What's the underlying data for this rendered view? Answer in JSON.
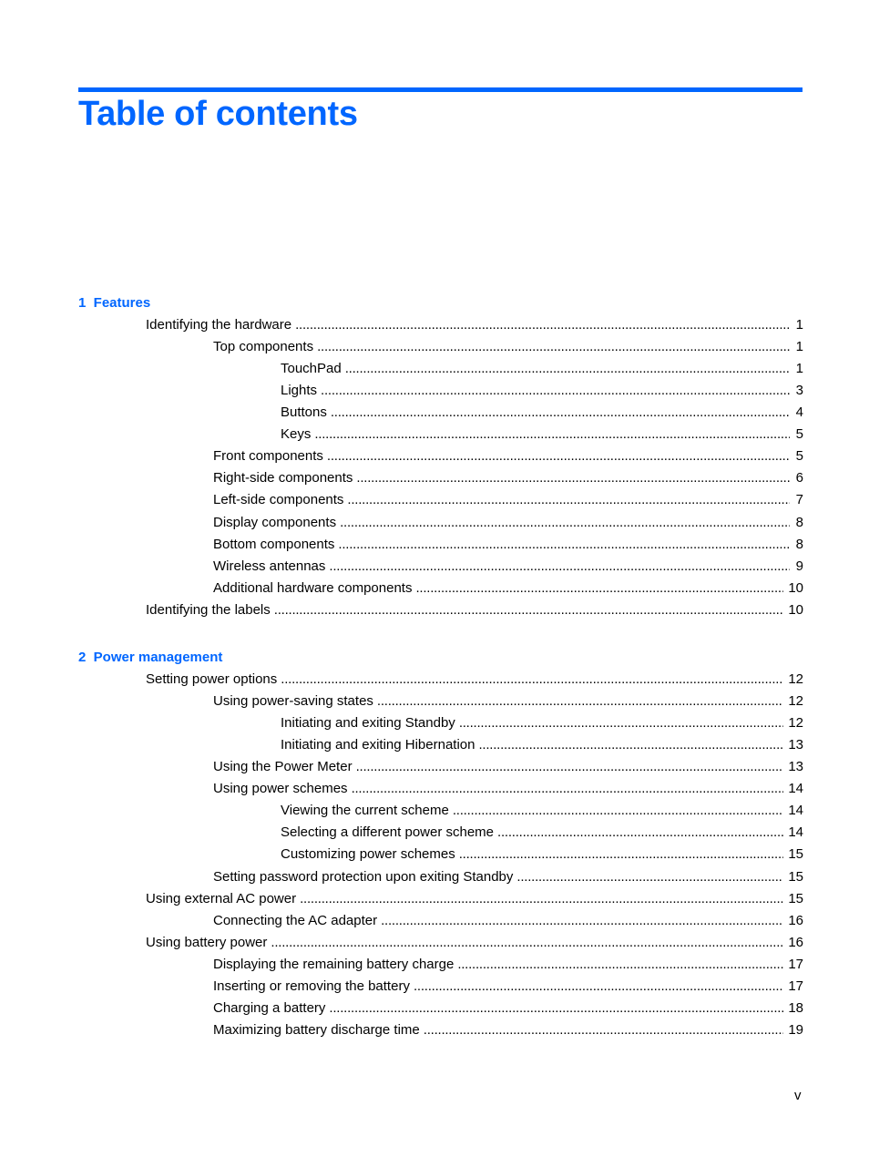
{
  "header": {
    "title": "Table of contents",
    "accent_color": "#0066ff"
  },
  "chapters": [
    {
      "heading": "1  Features",
      "entries": [
        {
          "level": 1,
          "label": "Identifying the hardware",
          "page": "1"
        },
        {
          "level": 2,
          "label": "Top components",
          "page": "1"
        },
        {
          "level": 3,
          "label": "TouchPad",
          "page": "1"
        },
        {
          "level": 3,
          "label": "Lights",
          "page": "3"
        },
        {
          "level": 3,
          "label": "Buttons",
          "page": "4"
        },
        {
          "level": 3,
          "label": "Keys",
          "page": "5"
        },
        {
          "level": 2,
          "label": "Front components",
          "page": "5"
        },
        {
          "level": 2,
          "label": "Right-side components",
          "page": "6"
        },
        {
          "level": 2,
          "label": "Left-side components",
          "page": "7"
        },
        {
          "level": 2,
          "label": "Display components",
          "page": "8"
        },
        {
          "level": 2,
          "label": "Bottom components",
          "page": "8"
        },
        {
          "level": 2,
          "label": "Wireless antennas",
          "page": "9"
        },
        {
          "level": 2,
          "label": "Additional hardware components",
          "page": "10"
        },
        {
          "level": 1,
          "label": "Identifying the labels",
          "page": "10"
        }
      ]
    },
    {
      "heading": "2  Power management",
      "entries": [
        {
          "level": 1,
          "label": "Setting power options",
          "page": "12"
        },
        {
          "level": 2,
          "label": "Using power-saving states",
          "page": "12"
        },
        {
          "level": 3,
          "label": "Initiating and exiting Standby",
          "page": "12"
        },
        {
          "level": 3,
          "label": "Initiating and exiting Hibernation",
          "page": "13"
        },
        {
          "level": 2,
          "label": "Using the Power Meter",
          "page": "13"
        },
        {
          "level": 2,
          "label": "Using power schemes",
          "page": "14"
        },
        {
          "level": 3,
          "label": "Viewing the current scheme",
          "page": "14"
        },
        {
          "level": 3,
          "label": "Selecting a different power scheme",
          "page": "14"
        },
        {
          "level": 3,
          "label": "Customizing power schemes",
          "page": "15"
        },
        {
          "level": 2,
          "label": "Setting password protection upon exiting Standby",
          "page": "15"
        },
        {
          "level": 1,
          "label": "Using external AC power",
          "page": "15"
        },
        {
          "level": 2,
          "label": "Connecting the AC adapter",
          "page": "16"
        },
        {
          "level": 1,
          "label": "Using battery power",
          "page": "16"
        },
        {
          "level": 2,
          "label": "Displaying the remaining battery charge",
          "page": "17"
        },
        {
          "level": 2,
          "label": "Inserting or removing the battery",
          "page": "17"
        },
        {
          "level": 2,
          "label": "Charging a battery",
          "page": "18"
        },
        {
          "level": 2,
          "label": "Maximizing battery discharge time",
          "page": "19"
        }
      ]
    }
  ],
  "footer": {
    "page_number": "v"
  }
}
